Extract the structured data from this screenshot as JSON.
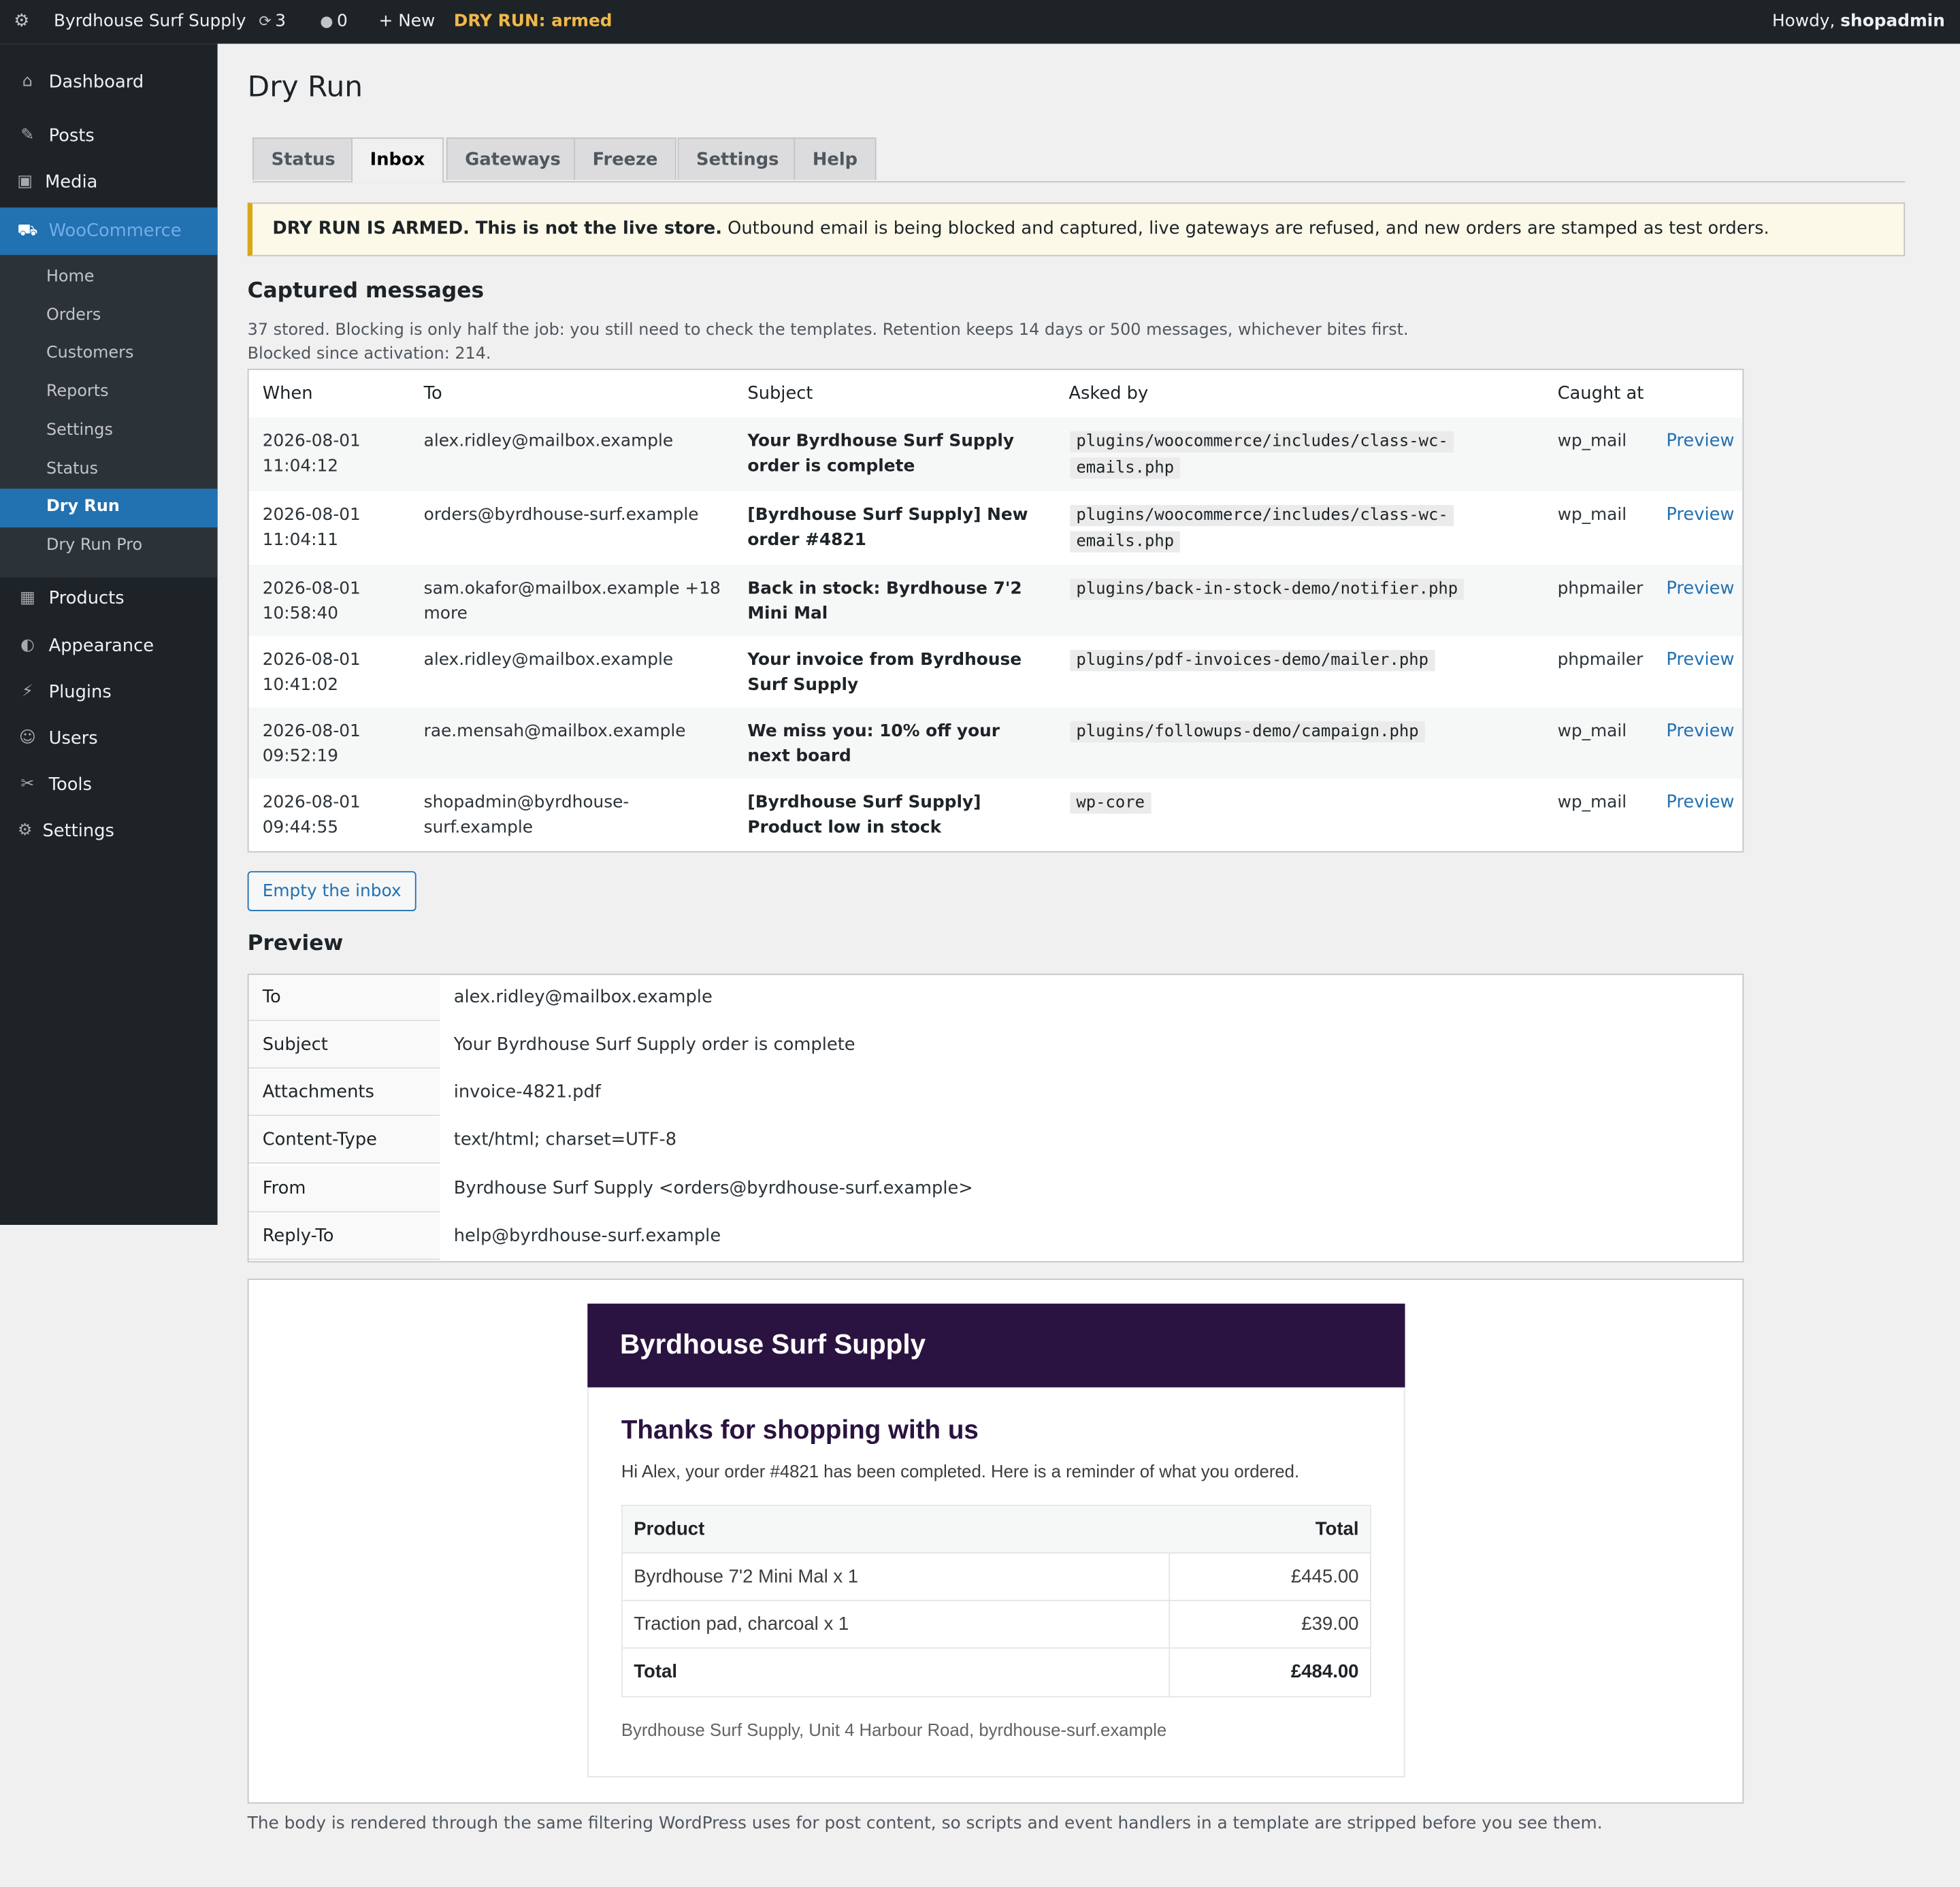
{
  "admin_bar": {
    "wp_icon": "wordpress-icon",
    "site_name": "Byrdhouse Surf Supply",
    "updates_count": "3",
    "comments_count": "0",
    "new_label": "+ New",
    "dry_run_status": "DRY RUN: armed",
    "howdy_prefix": "Howdy,",
    "username": "shopadmin"
  },
  "sidebar": {
    "dashboard": "Dashboard",
    "posts": "Posts",
    "media": "Media",
    "woocommerce": "WooCommerce",
    "woo_sub": {
      "home": "Home",
      "orders": "Orders",
      "customers": "Customers",
      "reports": "Reports",
      "settings": "Settings",
      "status": "Status",
      "dry_run": "Dry Run",
      "dry_run_pro": "Dry Run Pro"
    },
    "products": "Products",
    "appearance": "Appearance",
    "plugins": "Plugins",
    "users": "Users",
    "tools": "Tools",
    "settings": "Settings"
  },
  "page": {
    "title": "Dry Run",
    "tabs": [
      "Status",
      "Inbox",
      "Gateways",
      "Freeze",
      "Settings",
      "Help"
    ],
    "active_tab": "Inbox",
    "notice_strong": "DRY RUN IS ARMED. This is not the live store.",
    "notice_rest": " Outbound email is being blocked and captured, live gateways are refused, and new orders are stamped as test orders."
  },
  "captured": {
    "heading": "Captured messages",
    "desc_line1": "37 stored. Blocking is only half the job: you still need to check the templates. Retention keeps 14 days or 500 messages, whichever bites first.",
    "desc_line2": "Blocked since activation: 214.",
    "columns": [
      "When",
      "To",
      "Subject",
      "Asked by",
      "Caught at"
    ],
    "rows": [
      {
        "when": "2026-08-01 11:04:12",
        "to": "alex.ridley@mailbox.example",
        "subject": "Your Byrdhouse Surf Supply order is complete",
        "asked_by": "plugins/woocommerce/includes/class-wc-emails.php",
        "caught_at": "wp_mail",
        "action": "Preview"
      },
      {
        "when": "2026-08-01 11:04:11",
        "to": "orders@byrdhouse-surf.example",
        "subject": "[Byrdhouse Surf Supply] New order #4821",
        "asked_by": "plugins/woocommerce/includes/class-wc-emails.php",
        "caught_at": "wp_mail",
        "action": "Preview"
      },
      {
        "when": "2026-08-01 10:58:40",
        "to": "sam.okafor@mailbox.example +18 more",
        "subject": "Back in stock: Byrdhouse 7'2 Mini Mal",
        "asked_by": "plugins/back-in-stock-demo/notifier.php",
        "caught_at": "phpmailer",
        "action": "Preview"
      },
      {
        "when": "2026-08-01 10:41:02",
        "to": "alex.ridley@mailbox.example",
        "subject": "Your invoice from Byrdhouse Surf Supply",
        "asked_by": "plugins/pdf-invoices-demo/mailer.php",
        "caught_at": "phpmailer",
        "action": "Preview"
      },
      {
        "when": "2026-08-01 09:52:19",
        "to": "rae.mensah@mailbox.example",
        "subject": "We miss you: 10% off your next board",
        "asked_by": "plugins/followups-demo/campaign.php",
        "caught_at": "wp_mail",
        "action": "Preview"
      },
      {
        "when": "2026-08-01 09:44:55",
        "to": "shopadmin@byrdhouse-surf.example",
        "subject": "[Byrdhouse Surf Supply] Product low in stock",
        "asked_by": "wp-core",
        "caught_at": "wp_mail",
        "action": "Preview"
      }
    ],
    "empty_button": "Empty the inbox"
  },
  "preview": {
    "heading": "Preview",
    "headers": [
      {
        "key": "To",
        "value": "alex.ridley@mailbox.example"
      },
      {
        "key": "Subject",
        "value": "Your Byrdhouse Surf Supply order is complete"
      },
      {
        "key": "Attachments",
        "value": "invoice-4821.pdf"
      },
      {
        "key": "Content-Type",
        "value": "text/html; charset=UTF-8"
      },
      {
        "key": "From",
        "value": "Byrdhouse Surf Supply <orders@byrdhouse-surf.example>"
      },
      {
        "key": "Reply-To",
        "value": "help@byrdhouse-surf.example"
      }
    ],
    "email": {
      "brand": "Byrdhouse Surf Supply",
      "heading": "Thanks for shopping with us",
      "intro": "Hi Alex, your order #4821 has been completed. Here is a reminder of what you ordered.",
      "col_product": "Product",
      "col_total": "Total",
      "items": [
        {
          "product": "Byrdhouse 7'2 Mini Mal x 1",
          "total": "£445.00"
        },
        {
          "product": "Traction pad, charcoal x 1",
          "total": "£39.00"
        }
      ],
      "total_label": "Total",
      "total_value": "£484.00",
      "footer": "Byrdhouse Surf Supply, Unit 4 Harbour Road, byrdhouse-surf.example"
    },
    "footnote": "The body is rendered through the same filtering WordPress uses for post content, so scripts and event handlers in a template are stripped before you see them."
  },
  "colors": {
    "admin_bg": "#1d2327",
    "accent": "#2271b1",
    "dry_run_badge": "#f0b849",
    "notice_border": "#dba617",
    "email_header": "#2a1340"
  }
}
